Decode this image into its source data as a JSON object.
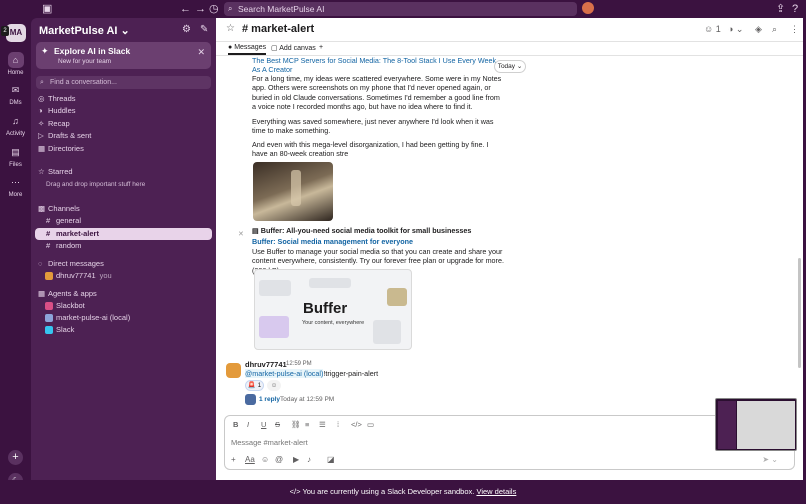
{
  "topbar": {
    "search_placeholder": "Search MarketPulse AI"
  },
  "rail": {
    "workspace_initials": "MA",
    "workspace_badge": "2",
    "items": [
      {
        "label": "Home",
        "icon": "home-icon"
      },
      {
        "label": "DMs",
        "icon": "dms-icon"
      },
      {
        "label": "Activity",
        "icon": "bell-icon"
      },
      {
        "label": "Files",
        "icon": "files-icon"
      },
      {
        "label": "More",
        "icon": "more-icon"
      }
    ]
  },
  "sidebar": {
    "workspace_name": "MarketPulse AI",
    "promo": {
      "title": "Explore AI in Slack",
      "subtitle": "New for your team"
    },
    "find_placeholder": "Find a conversation...",
    "nav": [
      "Threads",
      "Huddles",
      "Recap",
      "Drafts & sent",
      "Directories"
    ],
    "starred": {
      "label": "Starred",
      "hint": "Drag and drop important stuff here"
    },
    "channels": {
      "label": "Channels",
      "items": [
        "general",
        "market-alert",
        "random"
      ]
    },
    "dms": {
      "label": "Direct messages",
      "user": "dhruv77741",
      "you": "you"
    },
    "apps": {
      "label": "Agents & apps",
      "items": [
        "Slackbot",
        "market-pulse-ai (local)",
        "Slack"
      ]
    }
  },
  "channel": {
    "title": "# market-alert",
    "member_count": "1",
    "tabs": [
      "Messages",
      "Add canvas"
    ],
    "today": "Today"
  },
  "feed": {
    "link_title": "The Best MCP Servers for Social Media: The 8-Tool Stack I Use Every Week As A Creator",
    "p1": "For a long time, my ideas were scattered everywhere. Some were in my Notes app. Others were screenshots on my phone that I'd never opened again, or buried in old Claude conversations. Sometimes I'd remember a good line from a voice note I recorded months ago, but have no idea where to find it.",
    "p2": "Everything was saved somewhere, just never anywhere I'd look when it was time to make something.",
    "p3": "And even with this mega-level disorganization, I had been getting by fine. I have an 80-week creation stre",
    "unfurl_site": "Buffer: All-you-need social media toolkit for small businesses",
    "unfurl_link": "Buffer: Social media management for everyone",
    "unfurl_desc": "Use Buffer to manage your social media so that you can create and share your content everywhere, consistently. Try our forever free plan or upgrade for more. (206 kB)",
    "buffer_logo": "Buffer",
    "buffer_sub": "Your content, everywhere",
    "sender": "dhruv77741",
    "time": "12:59 PM",
    "mention": "@market-pulse-ai (local)",
    "command": "!trigger-pain-alert",
    "reaction_count": "1",
    "reply_count": "1 reply",
    "reply_time": "Today at 12:59 PM"
  },
  "composer": {
    "placeholder": "Message #market-alert"
  },
  "banner": {
    "text": "You are currently using a Slack Developer sandbox.",
    "link": "View details"
  }
}
